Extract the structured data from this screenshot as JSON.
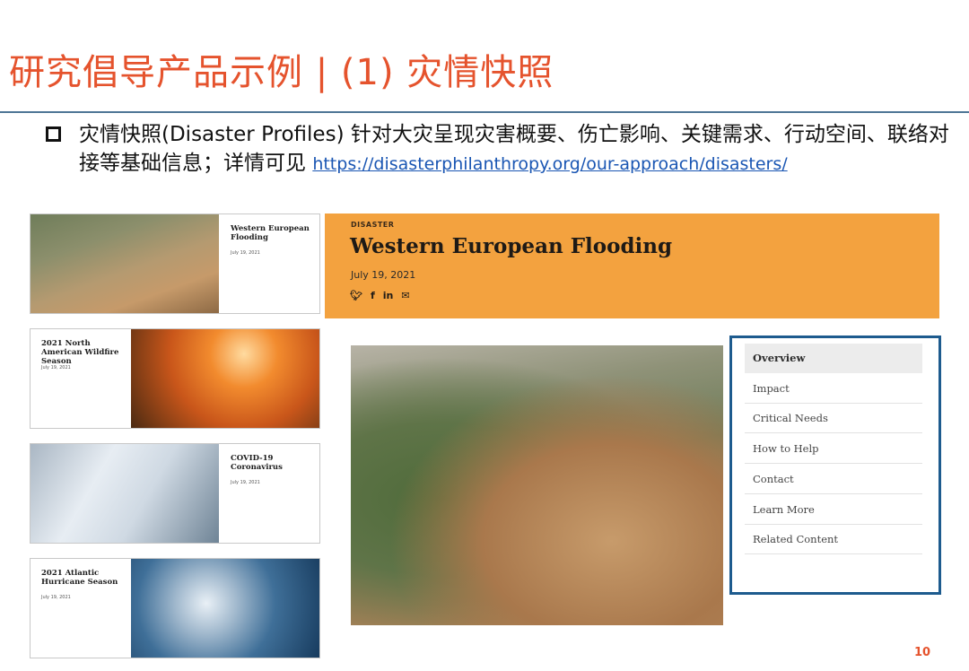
{
  "slide": {
    "title": "研究倡导产品示例 | (1) 灾情快照",
    "body_text": "灾情快照(Disaster Profiles) 针对大灾呈现灾害概要、伤亡影响、关键需求、行动空间、联络对接等基础信息；详情可见 ",
    "link_text": "https://disasterphilanthropy.org/our-approach/disasters/",
    "page_number": "10"
  },
  "thumbnails": [
    {
      "title": "Western European Flooding",
      "date": "July 19, 2021"
    },
    {
      "title": "2021 North American Wildfire Season",
      "date": "July 19, 2021"
    },
    {
      "title": "COVID-19 Coronavirus",
      "date": "July 19, 2021"
    },
    {
      "title": "2021 Atlantic Hurricane Season",
      "date": "July 19, 2021"
    }
  ],
  "hero": {
    "tag": "DISASTER",
    "title": "Western European Flooding",
    "date": "July 19, 2021",
    "share_icons": [
      "twitter-icon",
      "facebook-icon",
      "linkedin-icon",
      "email-icon"
    ]
  },
  "nav": {
    "items": [
      "Overview",
      "Impact",
      "Critical Needs",
      "How to Help",
      "Contact",
      "Learn More",
      "Related Content"
    ],
    "active": "Overview"
  },
  "colors": {
    "title": "#e5532d",
    "rule": "#4e7595",
    "hero_bg": "#f3a23f",
    "nav_border": "#1d5b8e",
    "link": "#1a56b3"
  }
}
